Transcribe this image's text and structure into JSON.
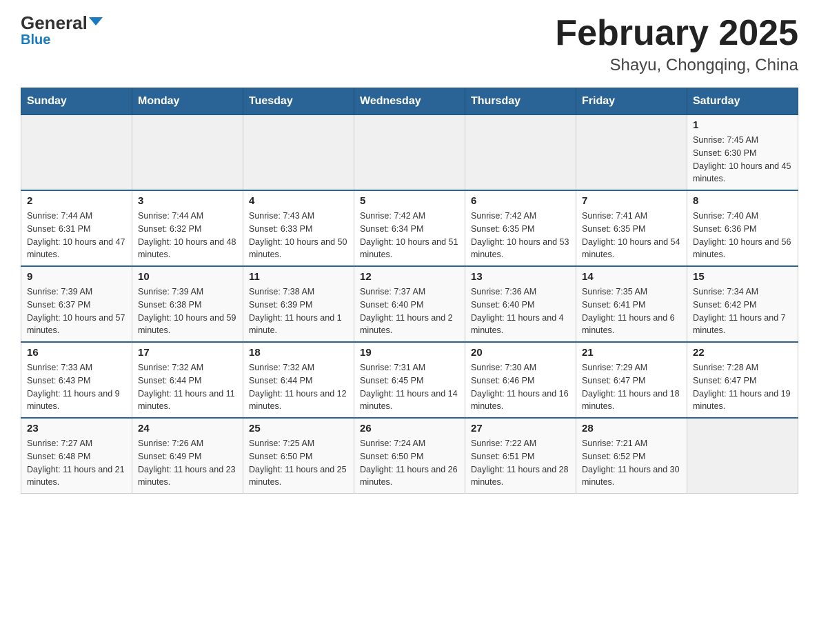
{
  "header": {
    "logo_general": "General",
    "logo_blue": "Blue",
    "title": "February 2025",
    "subtitle": "Shayu, Chongqing, China"
  },
  "days_of_week": [
    "Sunday",
    "Monday",
    "Tuesday",
    "Wednesday",
    "Thursday",
    "Friday",
    "Saturday"
  ],
  "weeks": [
    [
      {
        "day": "",
        "info": ""
      },
      {
        "day": "",
        "info": ""
      },
      {
        "day": "",
        "info": ""
      },
      {
        "day": "",
        "info": ""
      },
      {
        "day": "",
        "info": ""
      },
      {
        "day": "",
        "info": ""
      },
      {
        "day": "1",
        "info": "Sunrise: 7:45 AM\nSunset: 6:30 PM\nDaylight: 10 hours and 45 minutes."
      }
    ],
    [
      {
        "day": "2",
        "info": "Sunrise: 7:44 AM\nSunset: 6:31 PM\nDaylight: 10 hours and 47 minutes."
      },
      {
        "day": "3",
        "info": "Sunrise: 7:44 AM\nSunset: 6:32 PM\nDaylight: 10 hours and 48 minutes."
      },
      {
        "day": "4",
        "info": "Sunrise: 7:43 AM\nSunset: 6:33 PM\nDaylight: 10 hours and 50 minutes."
      },
      {
        "day": "5",
        "info": "Sunrise: 7:42 AM\nSunset: 6:34 PM\nDaylight: 10 hours and 51 minutes."
      },
      {
        "day": "6",
        "info": "Sunrise: 7:42 AM\nSunset: 6:35 PM\nDaylight: 10 hours and 53 minutes."
      },
      {
        "day": "7",
        "info": "Sunrise: 7:41 AM\nSunset: 6:35 PM\nDaylight: 10 hours and 54 minutes."
      },
      {
        "day": "8",
        "info": "Sunrise: 7:40 AM\nSunset: 6:36 PM\nDaylight: 10 hours and 56 minutes."
      }
    ],
    [
      {
        "day": "9",
        "info": "Sunrise: 7:39 AM\nSunset: 6:37 PM\nDaylight: 10 hours and 57 minutes."
      },
      {
        "day": "10",
        "info": "Sunrise: 7:39 AM\nSunset: 6:38 PM\nDaylight: 10 hours and 59 minutes."
      },
      {
        "day": "11",
        "info": "Sunrise: 7:38 AM\nSunset: 6:39 PM\nDaylight: 11 hours and 1 minute."
      },
      {
        "day": "12",
        "info": "Sunrise: 7:37 AM\nSunset: 6:40 PM\nDaylight: 11 hours and 2 minutes."
      },
      {
        "day": "13",
        "info": "Sunrise: 7:36 AM\nSunset: 6:40 PM\nDaylight: 11 hours and 4 minutes."
      },
      {
        "day": "14",
        "info": "Sunrise: 7:35 AM\nSunset: 6:41 PM\nDaylight: 11 hours and 6 minutes."
      },
      {
        "day": "15",
        "info": "Sunrise: 7:34 AM\nSunset: 6:42 PM\nDaylight: 11 hours and 7 minutes."
      }
    ],
    [
      {
        "day": "16",
        "info": "Sunrise: 7:33 AM\nSunset: 6:43 PM\nDaylight: 11 hours and 9 minutes."
      },
      {
        "day": "17",
        "info": "Sunrise: 7:32 AM\nSunset: 6:44 PM\nDaylight: 11 hours and 11 minutes."
      },
      {
        "day": "18",
        "info": "Sunrise: 7:32 AM\nSunset: 6:44 PM\nDaylight: 11 hours and 12 minutes."
      },
      {
        "day": "19",
        "info": "Sunrise: 7:31 AM\nSunset: 6:45 PM\nDaylight: 11 hours and 14 minutes."
      },
      {
        "day": "20",
        "info": "Sunrise: 7:30 AM\nSunset: 6:46 PM\nDaylight: 11 hours and 16 minutes."
      },
      {
        "day": "21",
        "info": "Sunrise: 7:29 AM\nSunset: 6:47 PM\nDaylight: 11 hours and 18 minutes."
      },
      {
        "day": "22",
        "info": "Sunrise: 7:28 AM\nSunset: 6:47 PM\nDaylight: 11 hours and 19 minutes."
      }
    ],
    [
      {
        "day": "23",
        "info": "Sunrise: 7:27 AM\nSunset: 6:48 PM\nDaylight: 11 hours and 21 minutes."
      },
      {
        "day": "24",
        "info": "Sunrise: 7:26 AM\nSunset: 6:49 PM\nDaylight: 11 hours and 23 minutes."
      },
      {
        "day": "25",
        "info": "Sunrise: 7:25 AM\nSunset: 6:50 PM\nDaylight: 11 hours and 25 minutes."
      },
      {
        "day": "26",
        "info": "Sunrise: 7:24 AM\nSunset: 6:50 PM\nDaylight: 11 hours and 26 minutes."
      },
      {
        "day": "27",
        "info": "Sunrise: 7:22 AM\nSunset: 6:51 PM\nDaylight: 11 hours and 28 minutes."
      },
      {
        "day": "28",
        "info": "Sunrise: 7:21 AM\nSunset: 6:52 PM\nDaylight: 11 hours and 30 minutes."
      },
      {
        "day": "",
        "info": ""
      }
    ]
  ]
}
